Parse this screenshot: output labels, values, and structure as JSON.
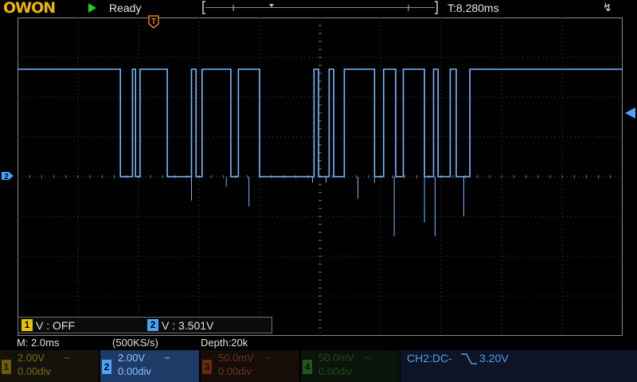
{
  "header": {
    "logo": "OWON",
    "status": "Ready",
    "trigger_time": "T:8.280ms",
    "usb": "↯"
  },
  "colors": {
    "ch1": "#e8c400",
    "ch2": "#4aa3ff",
    "ch3": "#b04a18",
    "ch4": "#1e6f1e",
    "trace": "#78b8ff",
    "grid": "#5a5a5a",
    "trigger_marker": "#e08020",
    "run": "#1fd01f"
  },
  "measurements": {
    "ch1_index": "1",
    "ch1_text": "V : OFF",
    "ch2_index": "2",
    "ch2_text": "V : 3.501V"
  },
  "info": {
    "timebase": "M: 2.0ms",
    "sample_rate": "(500KS/s)",
    "depth": "Depth:20k"
  },
  "channels": [
    {
      "index": "1",
      "volts": "2.00V",
      "coupling": "~",
      "offset": "0.00div"
    },
    {
      "index": "2",
      "volts": "2.00V",
      "coupling": "~",
      "offset": "0.00div"
    },
    {
      "index": "3",
      "volts": "50.0mV",
      "coupling": "~",
      "offset": "0.00div"
    },
    {
      "index": "4",
      "volts": "50.0mV",
      "coupling": "~",
      "offset": "0.00div"
    }
  ],
  "trigger": {
    "text": "CH2:DC-",
    "icon": "falling-edge-icon",
    "level": "3.20V"
  },
  "markers": {
    "trigger_position": "T",
    "ch2_ground": "2"
  },
  "waveform": {
    "high_volts": 5.4,
    "low_volts": 0.0,
    "volts_per_div": 2.0,
    "segments_ms": [
      [
        0,
        1,
        6.8
      ],
      [
        6.8,
        0,
        7.6
      ],
      [
        7.6,
        1,
        7.8
      ],
      [
        7.8,
        0,
        8.1
      ],
      [
        8.1,
        1,
        9.9
      ],
      [
        9.9,
        0,
        11.5
      ],
      [
        11.5,
        1,
        11.8
      ],
      [
        11.8,
        0,
        12.2
      ],
      [
        12.2,
        1,
        14.1
      ],
      [
        14.1,
        0,
        14.6
      ],
      [
        14.6,
        1,
        16.0
      ],
      [
        16.0,
        0,
        19.6
      ],
      [
        19.6,
        1,
        19.9
      ],
      [
        19.9,
        0,
        20.6
      ],
      [
        20.6,
        1,
        20.9
      ],
      [
        20.9,
        0,
        21.6
      ],
      [
        21.6,
        1,
        23.6
      ],
      [
        23.6,
        0,
        24.2
      ],
      [
        24.2,
        1,
        25.0
      ],
      [
        25.0,
        0,
        25.5
      ],
      [
        25.5,
        1,
        26.9
      ],
      [
        26.9,
        0,
        27.5
      ],
      [
        27.5,
        1,
        27.8
      ],
      [
        27.8,
        0,
        28.6
      ],
      [
        28.6,
        1,
        29.0
      ],
      [
        29.0,
        0,
        29.9
      ],
      [
        29.9,
        1,
        40.0
      ]
    ],
    "glitch_ms": [
      [
        11.5,
        -1.2
      ],
      [
        13.8,
        -0.5
      ],
      [
        15.3,
        -1.5
      ],
      [
        19.5,
        -0.3
      ],
      [
        20.4,
        -0.3
      ],
      [
        22.5,
        -1.1
      ],
      [
        23.6,
        -0.3
      ],
      [
        24.9,
        -3.0
      ],
      [
        26.9,
        -2.3
      ],
      [
        27.6,
        -3.0
      ],
      [
        29.5,
        -2.0
      ]
    ]
  }
}
